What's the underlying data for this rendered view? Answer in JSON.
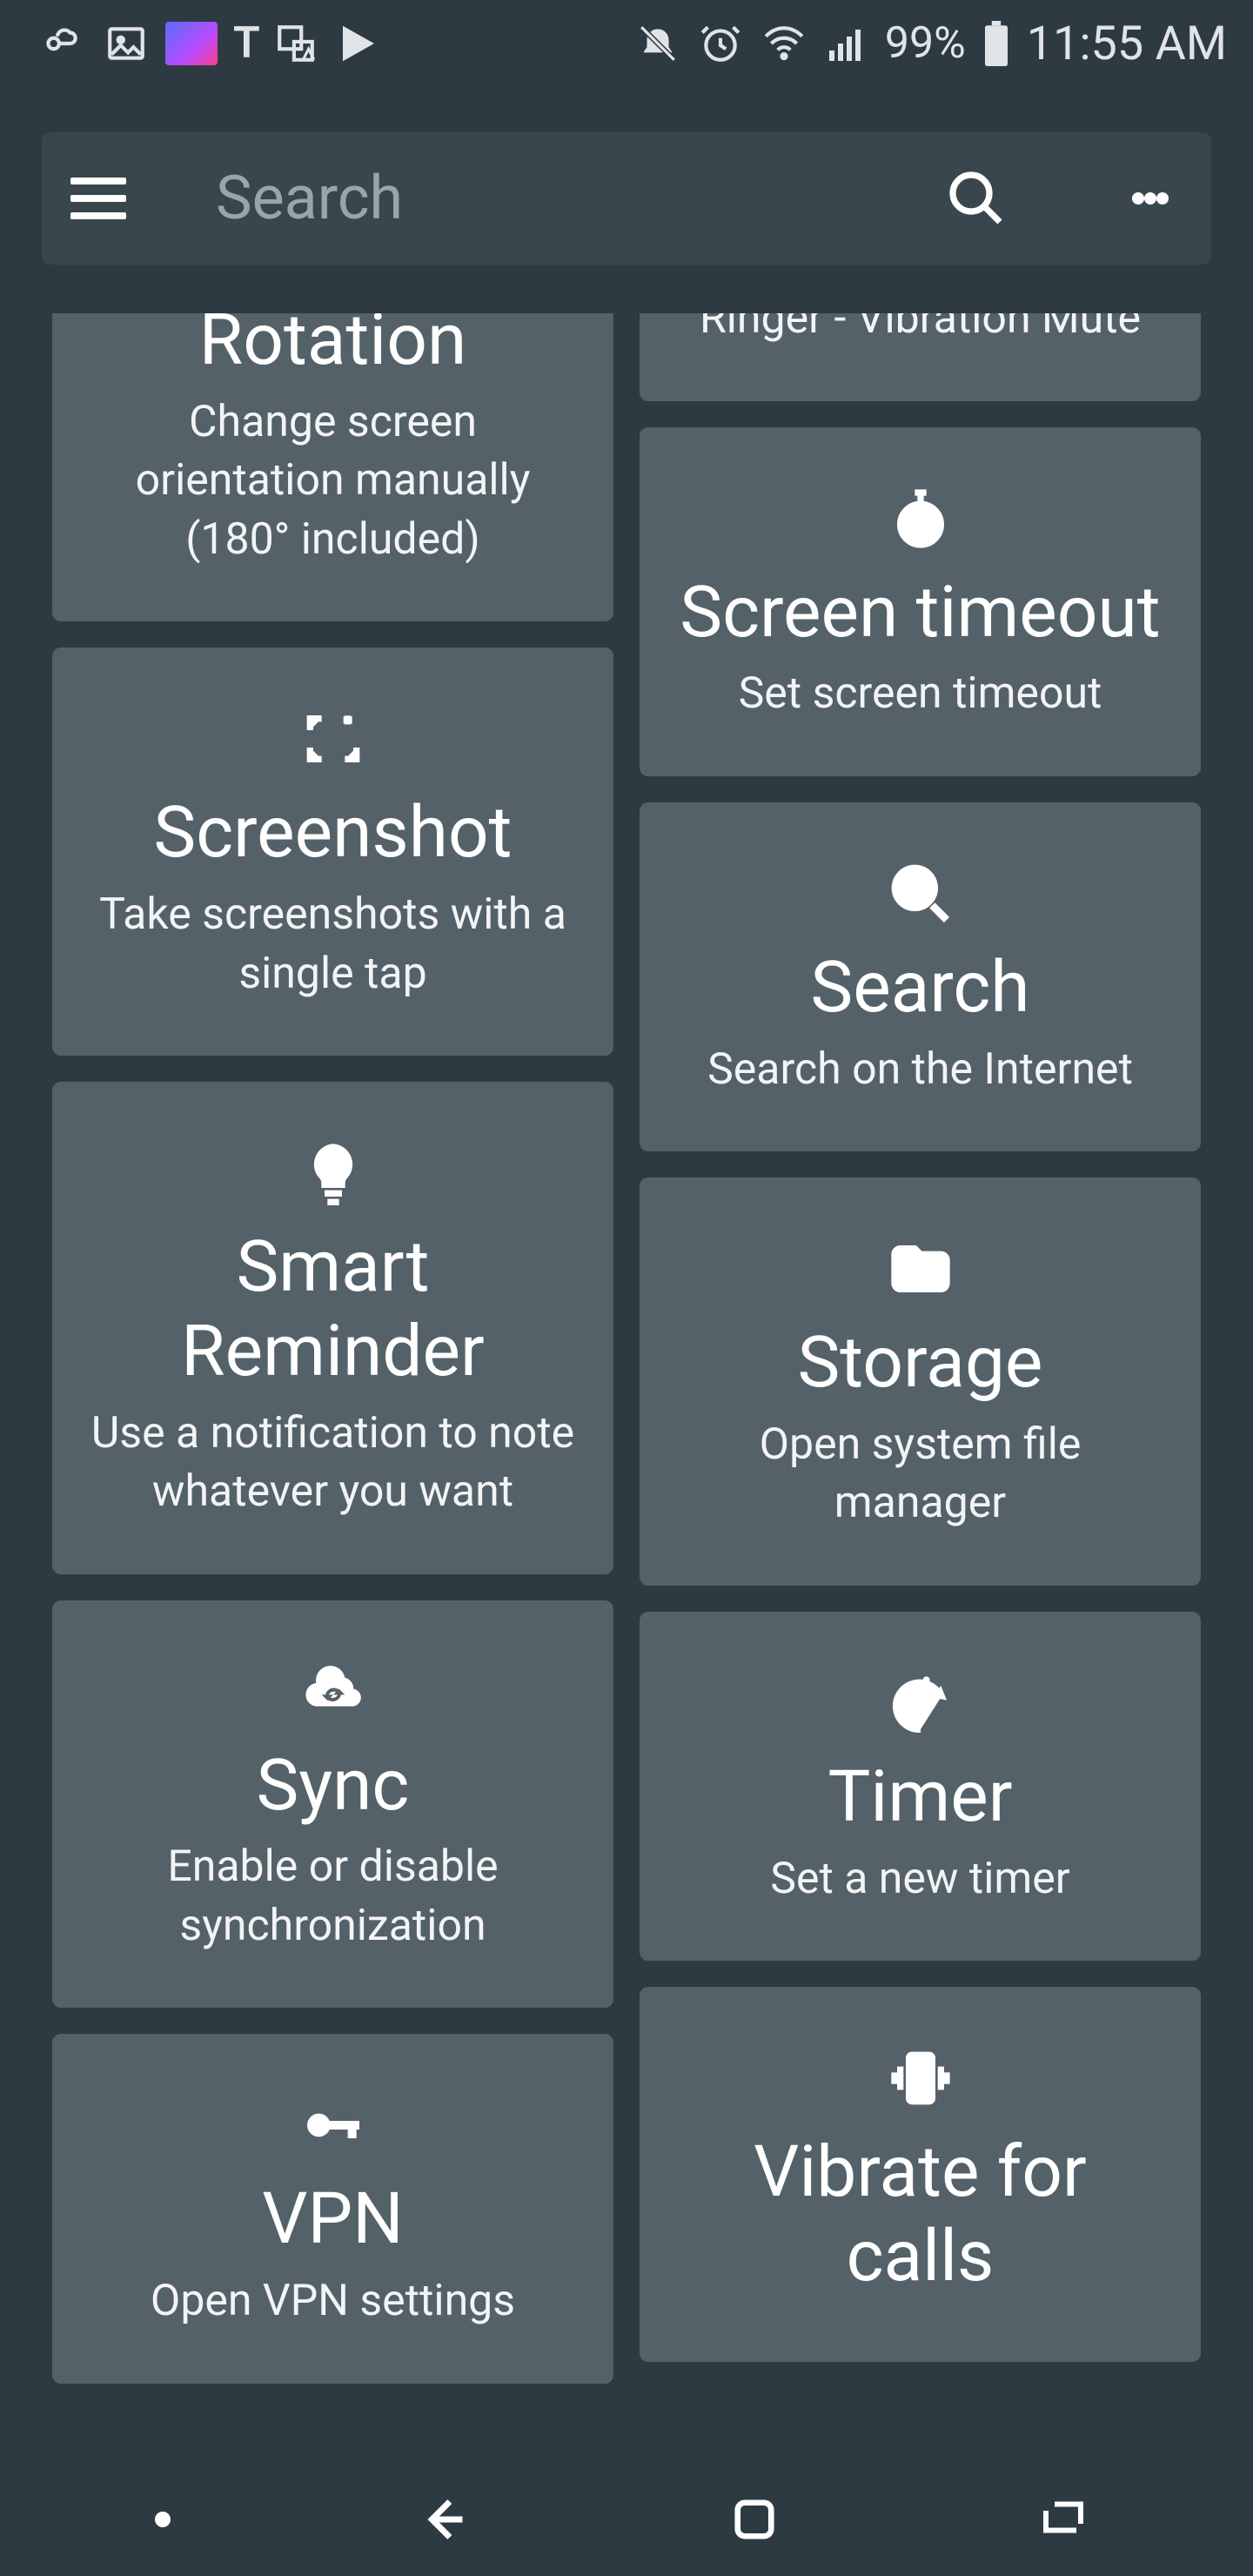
{
  "status": {
    "battery_pct": "99%",
    "time": "11:55 AM"
  },
  "appbar": {
    "search_placeholder": "Search"
  },
  "left": [
    {
      "id": "rotation",
      "title": "Rotation",
      "sub": "Change screen orientation manually (180° included)"
    },
    {
      "id": "screenshot",
      "title": "Screenshot",
      "sub": "Take screenshots with a single tap"
    },
    {
      "id": "smart-reminder",
      "title": "Smart Reminder",
      "sub": "Use a notification to note whatever you want"
    },
    {
      "id": "sync",
      "title": "Sync",
      "sub": "Enable or disable synchronization"
    },
    {
      "id": "vpn",
      "title": "VPN",
      "sub": "Open VPN settings"
    }
  ],
  "right": [
    {
      "id": "ringer-mute",
      "title": "",
      "sub": "Ringer - Vibration Mute"
    },
    {
      "id": "screen-timeout",
      "title": "Screen timeout",
      "sub": "Set screen timeout"
    },
    {
      "id": "search",
      "title": "Search",
      "sub": "Search on the Internet"
    },
    {
      "id": "storage",
      "title": "Storage",
      "sub": "Open system file manager"
    },
    {
      "id": "timer",
      "title": "Timer",
      "sub": "Set a new timer"
    },
    {
      "id": "vibrate-calls",
      "title": "Vibrate for calls",
      "sub": ""
    }
  ]
}
